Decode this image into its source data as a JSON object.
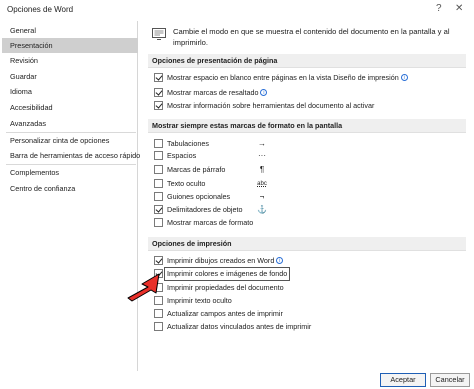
{
  "window": {
    "title": "Opciones de Word",
    "help_label": "?",
    "close_label": "✕"
  },
  "sidebar": {
    "items": [
      {
        "label": "General",
        "selected": false
      },
      {
        "label": "Presentación",
        "selected": true
      },
      {
        "label": "Revisión",
        "selected": false
      },
      {
        "label": "Guardar",
        "selected": false
      },
      {
        "label": "Idioma",
        "selected": false
      },
      {
        "label": "Accesibilidad",
        "selected": false
      },
      {
        "label": "Avanzadas",
        "selected": false
      },
      {
        "label": "Personalizar cinta de opciones",
        "selected": false
      },
      {
        "label": "Barra de herramientas de acceso rápido",
        "selected": false
      },
      {
        "label": "Complementos",
        "selected": false
      },
      {
        "label": "Centro de confianza",
        "selected": false
      }
    ]
  },
  "main": {
    "header_icon": "display-settings-icon",
    "header_text": "Cambie el modo en que se muestra el contenido del documento en la pantalla y al imprimirlo.",
    "page_section": {
      "title": "Opciones de presentación de página",
      "options": [
        {
          "label": "Mostrar espacio en blanco entre páginas en la vista Diseño de impresión",
          "checked": true,
          "info": true
        },
        {
          "label": "Mostrar marcas de resaltado",
          "checked": true,
          "info": true
        },
        {
          "label": "Mostrar información sobre herramientas del documento al activar",
          "checked": true,
          "info": false
        }
      ]
    },
    "format_section": {
      "title": "Mostrar siempre estas marcas de formato en la pantalla",
      "options": [
        {
          "label": "Tabulaciones",
          "checked": false,
          "symbol": "→"
        },
        {
          "label": "Espacios",
          "checked": false,
          "symbol": "···"
        },
        {
          "label": "Marcas de párrafo",
          "checked": false,
          "symbol": "¶"
        },
        {
          "label": "Texto oculto",
          "checked": false,
          "symbol": "abc"
        },
        {
          "label": "Guiones opcionales",
          "checked": false,
          "symbol": "¬"
        },
        {
          "label": "Delimitadores de objeto",
          "checked": true,
          "symbol": "⚓"
        },
        {
          "label": "Mostrar marcas de formato",
          "checked": false,
          "symbol": ""
        }
      ]
    },
    "print_section": {
      "title": "Opciones de impresión",
      "options": [
        {
          "label": "Imprimir dibujos creados en Word",
          "checked": true,
          "info": true,
          "focused": false
        },
        {
          "label": "Imprimir colores e imágenes de fondo",
          "checked": true,
          "info": false,
          "focused": true
        },
        {
          "label": "Imprimir propiedades del documento",
          "checked": false,
          "info": false,
          "focused": false
        },
        {
          "label": "Imprimir texto oculto",
          "checked": false,
          "info": false,
          "focused": false
        },
        {
          "label": "Actualizar campos antes de imprimir",
          "checked": false,
          "info": false,
          "focused": false
        },
        {
          "label": "Actualizar datos vinculados antes de imprimir",
          "checked": false,
          "info": false,
          "focused": false
        }
      ]
    }
  },
  "footer": {
    "accept_label": "Aceptar",
    "cancel_label": "Cancelar"
  },
  "annotation": {
    "arrow_color": "#e8302a"
  }
}
